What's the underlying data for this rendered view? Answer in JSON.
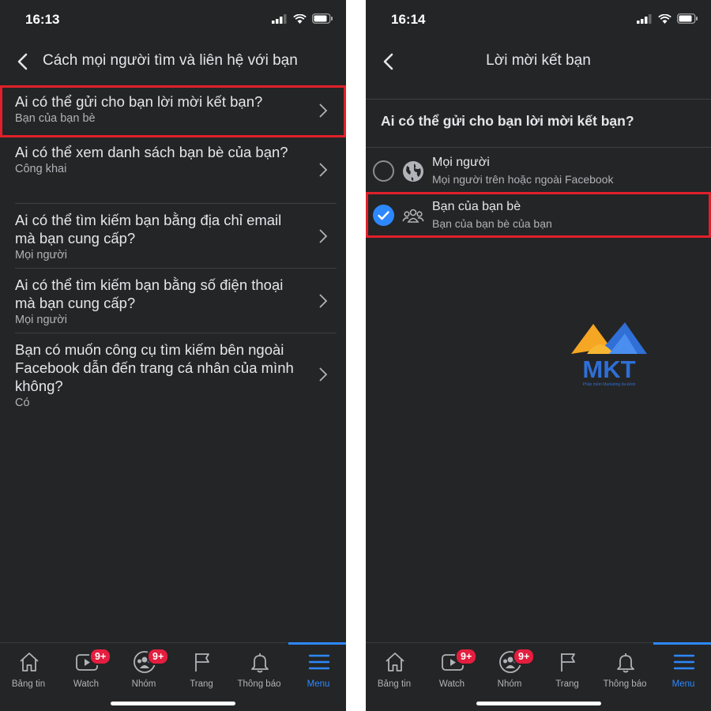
{
  "left": {
    "status": {
      "time": "16:13"
    },
    "header": {
      "title": "Cách mọi người tìm và liên hệ với bạn"
    },
    "settings": [
      {
        "question": "Ai có thể gửi cho bạn lời mời kết bạn?",
        "value": "Bạn của bạn bè"
      },
      {
        "question": "Ai có thể xem danh sách bạn bè của bạn?",
        "value": "Công khai"
      },
      {
        "question": "Ai có thể tìm kiếm bạn bằng địa chỉ email mà bạn cung cấp?",
        "value": "Mọi người"
      },
      {
        "question": "Ai có thể tìm kiếm bạn bằng số điện thoại mà bạn cung cấp?",
        "value": "Mọi người"
      },
      {
        "question": "Bạn có muốn công cụ tìm kiếm bên ngoài Facebook dẫn đến trang cá nhân của mình không?",
        "value": "Có"
      }
    ]
  },
  "right": {
    "status": {
      "time": "16:14"
    },
    "header": {
      "title": "Lời mời kết bạn"
    },
    "section_question": "Ai có thể gửi cho bạn lời mời kết bạn?",
    "options": [
      {
        "title": "Mọi người",
        "subtitle": "Mọi người trên hoặc ngoài Facebook",
        "icon": "globe-icon",
        "selected": false
      },
      {
        "title": "Bạn của bạn bè",
        "subtitle": "Bạn của bạn bè của bạn",
        "icon": "friends-icon",
        "selected": true
      }
    ]
  },
  "tabbar": {
    "tabs": [
      {
        "label": "Bảng tin",
        "icon": "home-icon"
      },
      {
        "label": "Watch",
        "icon": "watch-icon",
        "badge": "9+"
      },
      {
        "label": "Nhóm",
        "icon": "groups-icon",
        "badge": "9+"
      },
      {
        "label": "Trang",
        "icon": "flag-icon"
      },
      {
        "label": "Thông báo",
        "icon": "bell-icon"
      },
      {
        "label": "Menu",
        "icon": "menu-icon",
        "active": true
      }
    ]
  },
  "watermark": {
    "brand": "MKT",
    "tagline": "Phần mềm Marketing đa kênh"
  },
  "colors": {
    "background": "#242526",
    "accent": "#2d88ff",
    "highlight": "#e0202a",
    "badge": "#e41e3f"
  }
}
